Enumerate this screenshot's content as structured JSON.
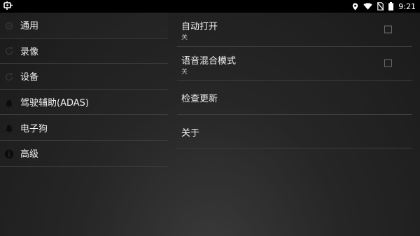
{
  "statusbar": {
    "app_icon": "car-dvr-icon",
    "icons": [
      "location-icon",
      "wifi-icon",
      "no-sim-icon",
      "battery-icon"
    ],
    "time": "9:21"
  },
  "sidebar": {
    "items": [
      {
        "label": "通用",
        "icon": "settings-icon"
      },
      {
        "label": "录像",
        "icon": "refresh-icon"
      },
      {
        "label": "设备",
        "icon": "refresh-icon"
      },
      {
        "label": "驾驶辅助(ADAS)",
        "icon": "bell-icon"
      },
      {
        "label": "电子狗",
        "icon": "bell-icon"
      },
      {
        "label": "高级",
        "icon": "info-icon"
      }
    ]
  },
  "settings": {
    "items": [
      {
        "title": "自动打开",
        "summary": "关",
        "checked": false
      },
      {
        "title": "语音混合模式",
        "summary": "关",
        "checked": false
      },
      {
        "title": "检查更新"
      },
      {
        "title": "关于"
      }
    ]
  },
  "colors": {
    "background": "#262626",
    "statusbar": "#000000",
    "divider": "#3e3e3e",
    "text": "#f0f0f0",
    "summary": "#bdbdbd"
  }
}
